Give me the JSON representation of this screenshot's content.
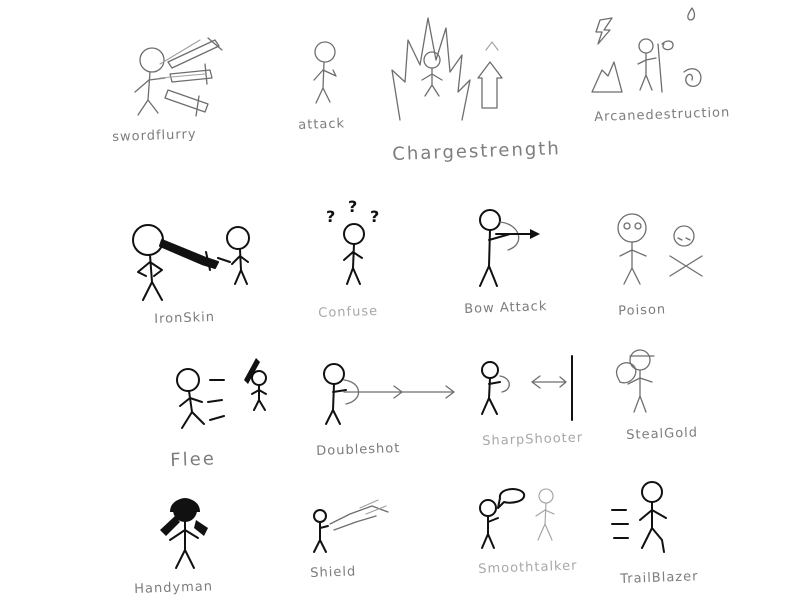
{
  "sketches": [
    {
      "id": "swordflurry",
      "label": "swordflurry"
    },
    {
      "id": "attack",
      "label": "attack"
    },
    {
      "id": "chargestrength",
      "label": "Chargestrength"
    },
    {
      "id": "arcanedestruction",
      "label": "Arcanedestruction"
    },
    {
      "id": "ironskin",
      "label": "IronSkin"
    },
    {
      "id": "confuse",
      "label": "Confuse"
    },
    {
      "id": "bowattack",
      "label": "Bow Attack"
    },
    {
      "id": "poison",
      "label": "Poison"
    },
    {
      "id": "flee",
      "label": "Flee"
    },
    {
      "id": "doubleshot",
      "label": "Doubleshot"
    },
    {
      "id": "sharpshooter",
      "label": "SharpShooter"
    },
    {
      "id": "stealgold",
      "label": "StealGold"
    },
    {
      "id": "handyman",
      "label": "Handyman"
    },
    {
      "id": "shield",
      "label": "Shield"
    },
    {
      "id": "smoothtalker",
      "label": "Smoothtalker"
    },
    {
      "id": "trailblazer",
      "label": "TrailBlazer"
    }
  ]
}
